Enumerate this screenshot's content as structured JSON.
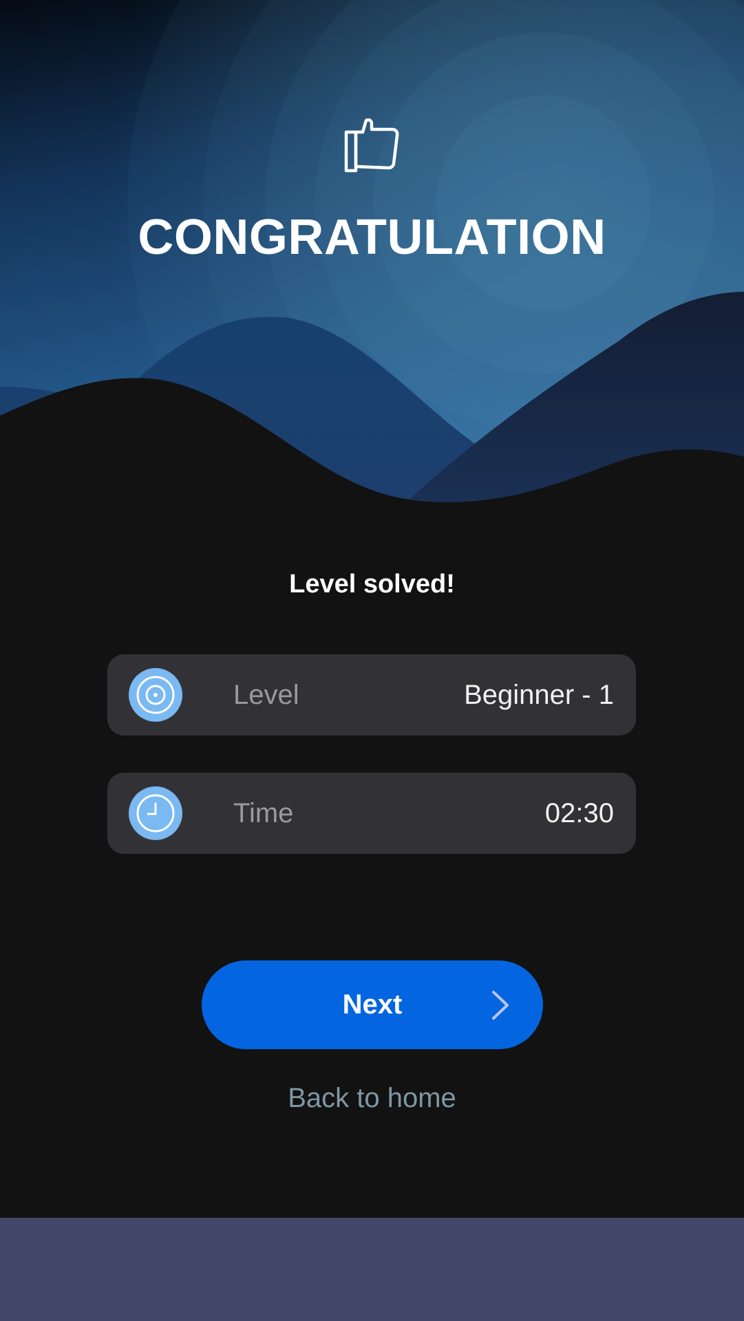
{
  "header": {
    "icon": "thumbs-up-icon",
    "title": "CONGRATULATION"
  },
  "result": {
    "message": "Level solved!"
  },
  "stats": {
    "level": {
      "icon": "target-icon",
      "label": "Level",
      "value": "Beginner - 1"
    },
    "time": {
      "icon": "clock-icon",
      "label": "Time",
      "value": "02:30"
    }
  },
  "actions": {
    "next_label": "Next",
    "next_icon": "chevron-right-icon",
    "back_label": "Back to home"
  },
  "colors": {
    "background": "#121212",
    "accent": "#0465e0",
    "card": "#323236",
    "icon_badge": "#7ab9f2",
    "link": "#7f97a3",
    "bottom_bar": "#424768"
  }
}
